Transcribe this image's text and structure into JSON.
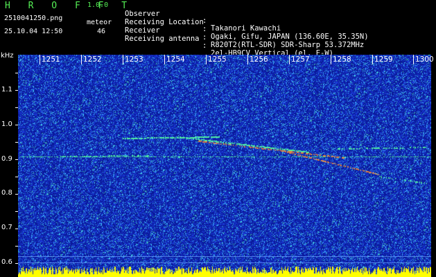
{
  "header": {
    "app_name": "H R O F F T",
    "app_version": "1.0.0",
    "filename": "2510041250.png",
    "timestamp": "25.10.04 12:50",
    "detection_label": "meteor",
    "detection_count": "46"
  },
  "metadata": [
    {
      "key": "Observer",
      "sep": ":",
      "value": "Takanori Kawachi"
    },
    {
      "key": "Receiving Location",
      "sep": ":",
      "value": "Ogaki, Gifu, JAPAN (136.60E, 35.35N)"
    },
    {
      "key": "Receiver",
      "sep": ":",
      "value": "R820T2(RTL-SDR) SDR-Sharp 53.372MHz"
    },
    {
      "key": "Receiving antenna",
      "sep": ":",
      "value": "2el-HB9CV Vertical (el. E-W)"
    }
  ],
  "axes": {
    "y_unit": "kHz",
    "y_ticks": [
      "1.1",
      "1.0",
      "0.9",
      "0.8",
      "0.7",
      "0.6"
    ],
    "x_ticks": [
      "1251",
      "1252",
      "1253",
      "1254",
      "1255",
      "1256",
      "1257",
      "1258",
      "1259",
      "1300"
    ]
  },
  "colors": {
    "background": "#0a1a9a",
    "noise_low": "#1a3ad8",
    "noise_mid": "#40c0ff",
    "signal": "#50f0a0",
    "signal_hot": "#e08040",
    "floor": "#ffff00"
  }
}
